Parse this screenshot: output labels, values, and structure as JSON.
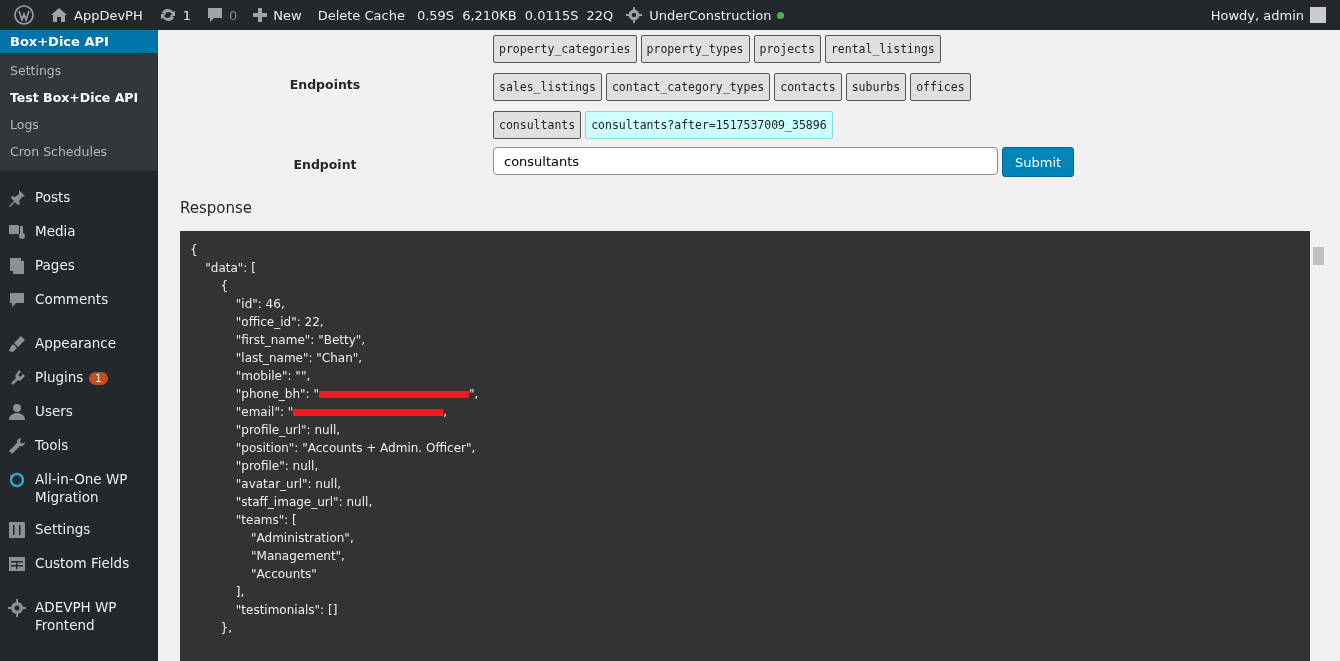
{
  "admin_bar": {
    "site": "AppDevPH",
    "updates": "1",
    "comments": "0",
    "new": "New",
    "delete_cache": "Delete Cache",
    "stats": [
      "0.59S",
      "6,210KB",
      "0.0115S",
      "22Q"
    ],
    "status": {
      "label": "UnderConstruction",
      "color": "#46b450"
    },
    "greeting": "Howdy, admin"
  },
  "sidebar": {
    "current": {
      "label": "Box+Dice API",
      "selected": true
    },
    "submenu": [
      {
        "label": "Settings",
        "selected": false
      },
      {
        "label": "Test Box+Dice API",
        "selected": true
      },
      {
        "label": "Logs",
        "selected": false
      },
      {
        "label": "Cron Schedules",
        "selected": false
      }
    ],
    "item_groups": [
      [
        {
          "label": "Posts"
        },
        {
          "label": "Media"
        },
        {
          "label": "Pages"
        },
        {
          "label": "Comments"
        }
      ],
      [
        {
          "label": "Appearance"
        },
        {
          "label": "Plugins",
          "badge": "1"
        },
        {
          "label": "Users"
        },
        {
          "label": "Tools"
        },
        {
          "label": "All-in-One WP Migration"
        },
        {
          "label": "Settings"
        },
        {
          "label": "Custom Fields"
        }
      ],
      [
        {
          "label": "ADEVPH WP Frontend"
        }
      ]
    ]
  },
  "form": {
    "endpoints_label": "Endpoints",
    "endpoint_rows": [
      [
        {
          "label": "property_categories",
          "kind": "button"
        },
        {
          "label": "property_types",
          "kind": "button"
        },
        {
          "label": "projects",
          "kind": "button"
        },
        {
          "label": "rental_listings",
          "kind": "button"
        }
      ],
      [
        {
          "label": "sales_listings",
          "kind": "button"
        },
        {
          "label": "contact_category_types",
          "kind": "button"
        },
        {
          "label": "contacts",
          "kind": "button"
        },
        {
          "label": "suburbs",
          "kind": "button"
        },
        {
          "label": "offices",
          "kind": "button"
        }
      ],
      [
        {
          "label": "consultants",
          "kind": "button"
        },
        {
          "label": "consultants?after=1517537009_35896",
          "kind": "cursor"
        }
      ]
    ],
    "endpoint_label": "Endpoint",
    "endpoint_value": "consultants",
    "submit": "Submit"
  },
  "response": {
    "title": "Response",
    "lines": [
      {
        "text": "{"
      },
      {
        "text": "    \"data\": ["
      },
      {
        "text": "        {"
      },
      {
        "text": "            \"id\": 46,"
      },
      {
        "text": "            \"office_id\": 22,"
      },
      {
        "text": "            \"first_name\": \"Betty\","
      },
      {
        "text": "            \"last_name\": \"Chan\","
      },
      {
        "text": "            \"mobile\": \"\","
      },
      {
        "text": "            \"phone_bh\": \"",
        "redacted": true,
        "after": "\","
      },
      {
        "text": "            \"email\": \"",
        "redacted": true,
        "after": ","
      },
      {
        "text": "            \"profile_url\": null,"
      },
      {
        "text": "            \"position\": \"Accounts + Admin. Officer\","
      },
      {
        "text": "            \"profile\": null,"
      },
      {
        "text": "            \"avatar_url\": null,"
      },
      {
        "text": "            \"staff_image_url\": null,"
      },
      {
        "text": "            \"teams\": ["
      },
      {
        "text": "                \"Administration\","
      },
      {
        "text": "                \"Management\","
      },
      {
        "text": "                \"Accounts\""
      },
      {
        "text": "            ],"
      },
      {
        "text": "            \"testimonials\": []"
      },
      {
        "text": "        },"
      }
    ]
  }
}
